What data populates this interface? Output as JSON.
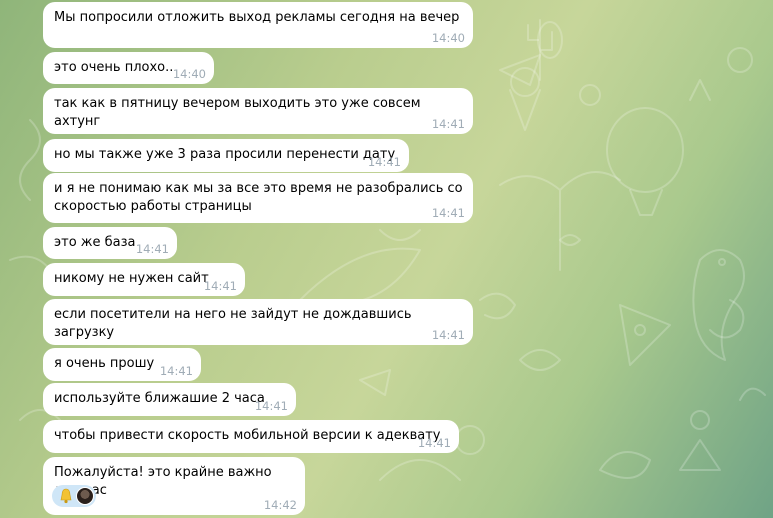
{
  "colors": {
    "bubble": "#ffffff",
    "timestamp": "#a0acb6",
    "reaction_chip": "#cfe6f7"
  },
  "messages": [
    {
      "text": "Мы попросили отложить выход рекламы сегодня на вечер",
      "time": "14:40"
    },
    {
      "text": "это очень плохо..",
      "time": "14:40"
    },
    {
      "text": "так как в пятницу вечером выходить это уже совсем ахтунг",
      "time": "14:41"
    },
    {
      "text": "но мы также уже 3 раза просили перенести дату",
      "time": "14:41"
    },
    {
      "text": "и я не понимаю как мы за все это время не разобрались со\nскоростью работы страницы",
      "time": "14:41"
    },
    {
      "text": "это же база",
      "time": "14:41"
    },
    {
      "text": "никому не нужен сайт",
      "time": "14:41"
    },
    {
      "text": "если посетители на него не зайдут не дождавшись загрузку",
      "time": "14:41"
    },
    {
      "text": "я очень прошу",
      "time": "14:41"
    },
    {
      "text": "используйте ближашие 2 часа",
      "time": "14:41"
    },
    {
      "text": "чтобы привести скорость мобильной версии к адеквату",
      "time": "14:41"
    },
    {
      "text": "Пожалуйста! это крайне важно для нас",
      "time": "14:42"
    }
  ],
  "reaction": {
    "emoji_icon": "bell-emoji-icon",
    "reactor": "avatar"
  }
}
